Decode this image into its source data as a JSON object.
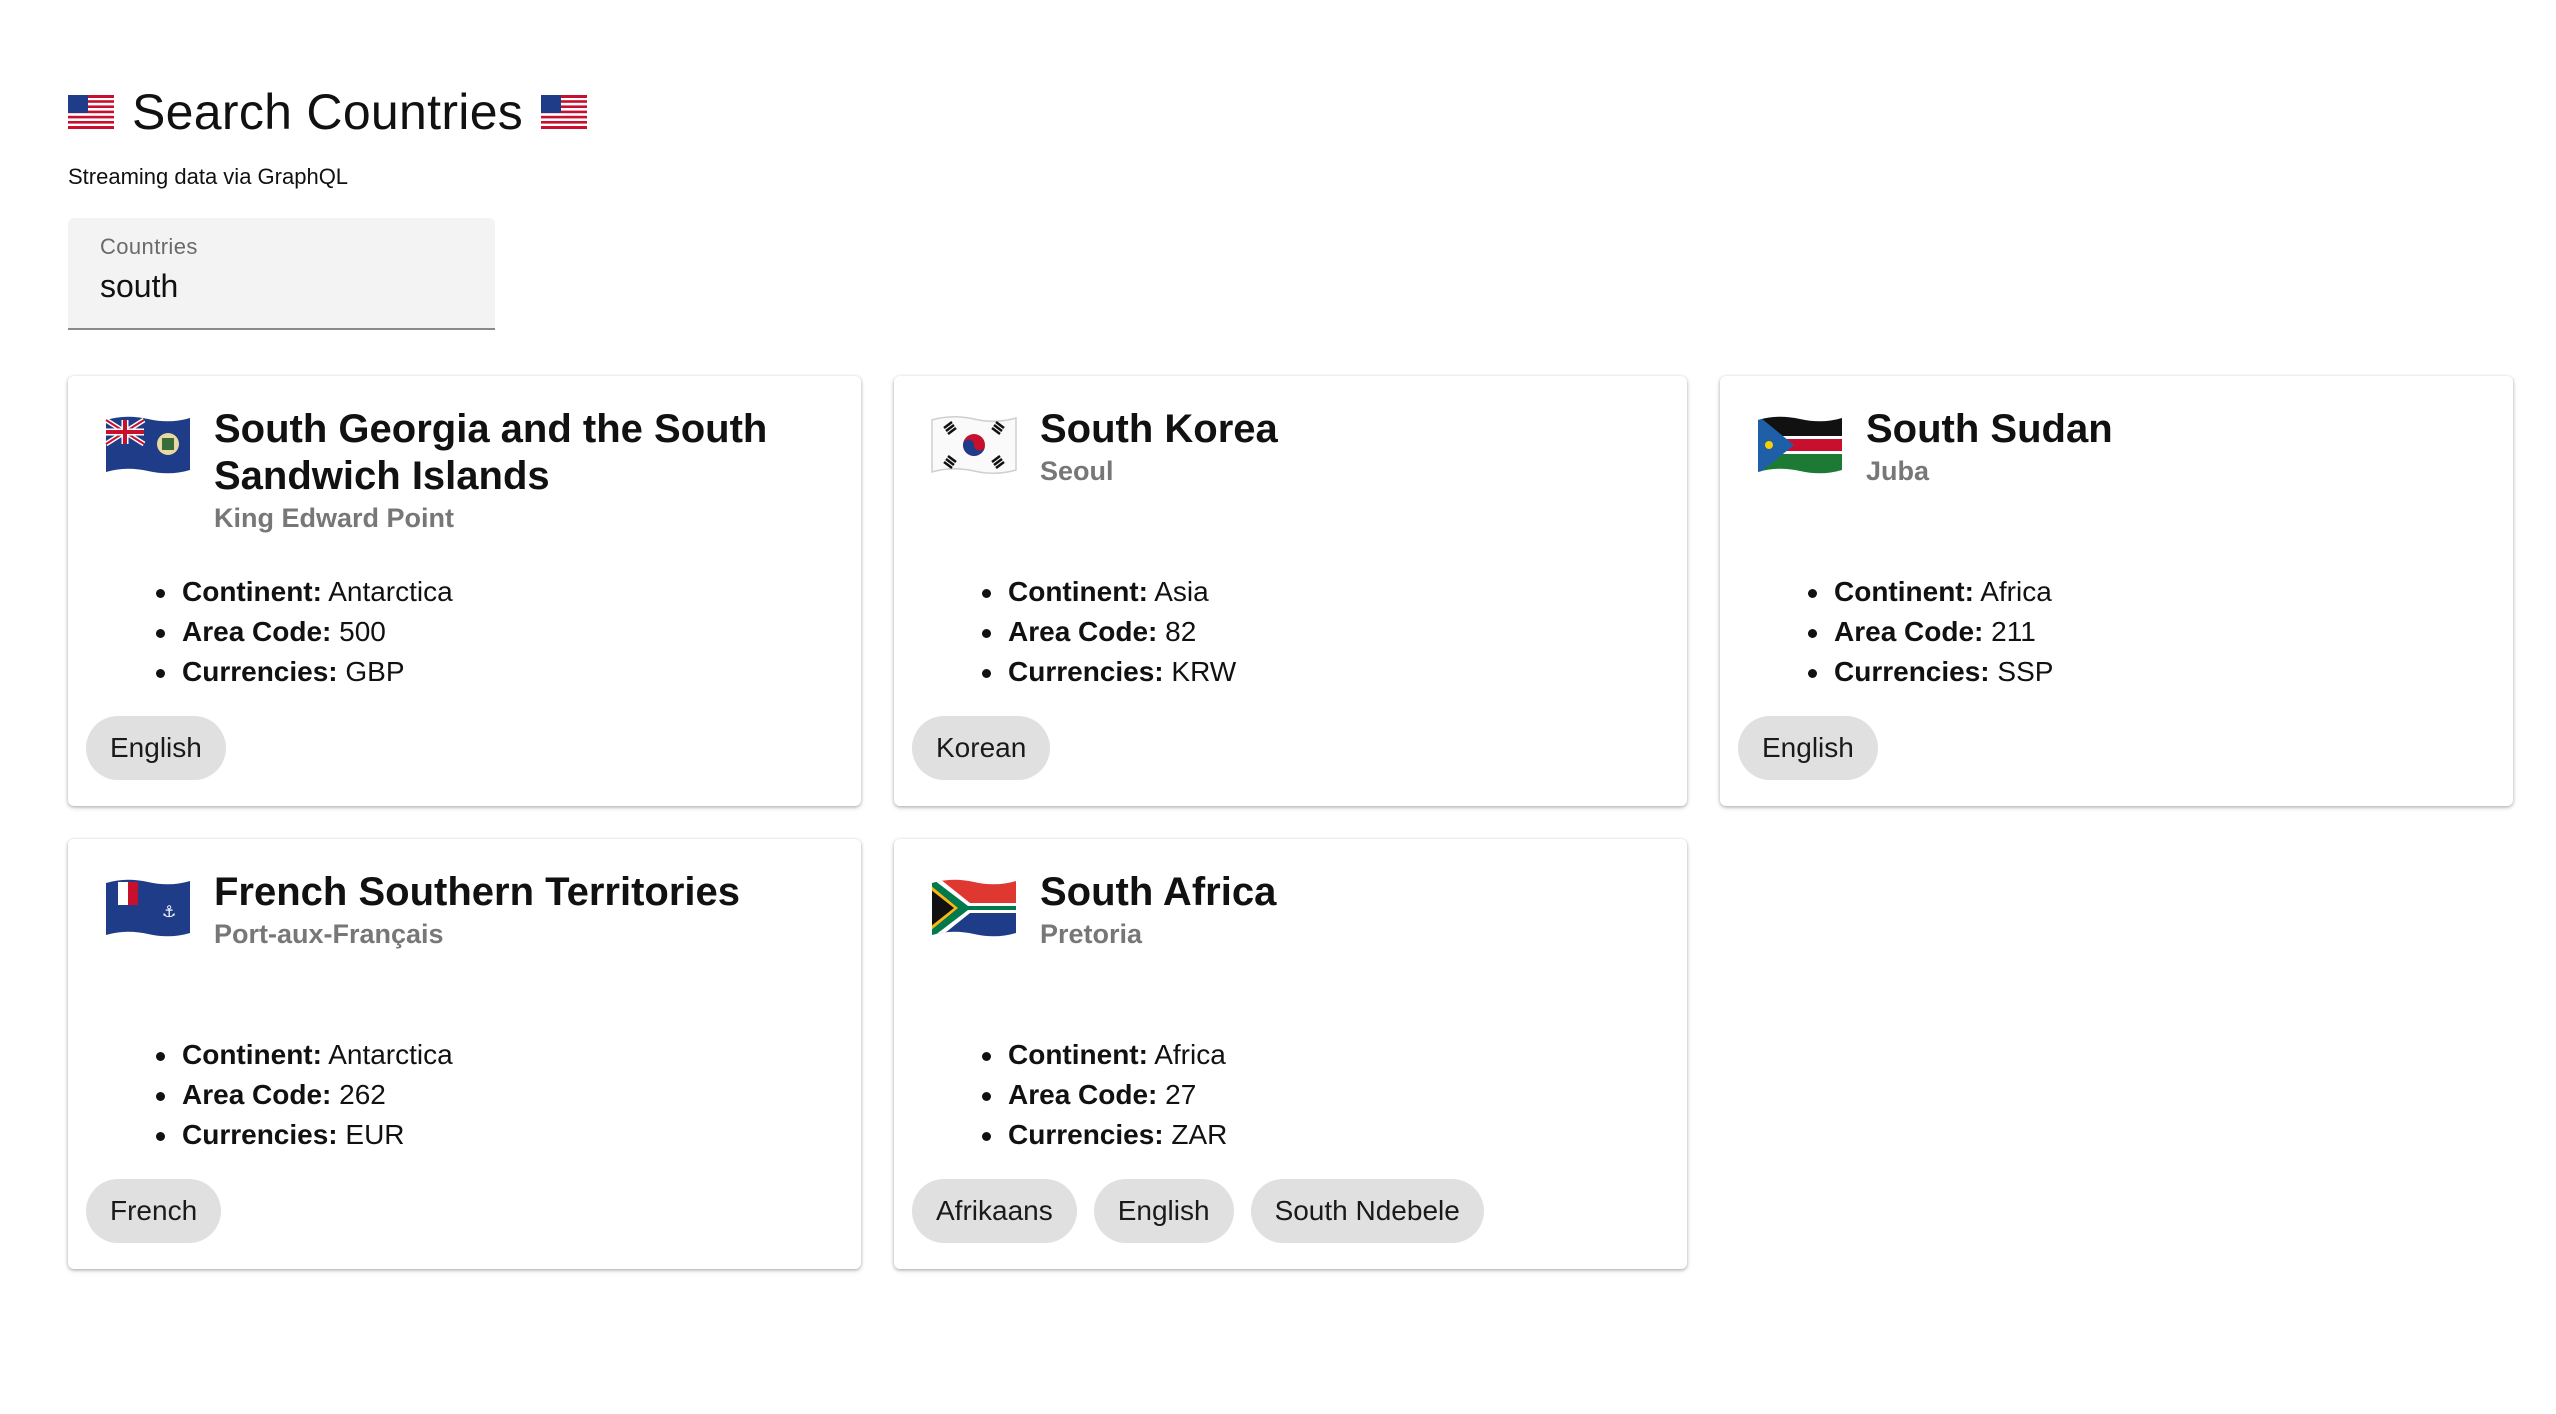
{
  "header": {
    "title": "Search Countries",
    "subtitle": "Streaming data via GraphQL",
    "title_flag_icon": "us-flag-icon"
  },
  "search": {
    "label": "Countries",
    "value": "south"
  },
  "fact_labels": {
    "continent": "Continent:",
    "area_code": "Area Code:",
    "currencies": "Currencies:"
  },
  "countries": [
    {
      "name": "South Georgia and the South Sandwich Islands",
      "capital": "King Edward Point",
      "continent": "Antarctica",
      "area_code": "500",
      "currencies": "GBP",
      "languages": [
        "English"
      ],
      "flag_icon": "south-georgia-flag-icon"
    },
    {
      "name": "South Korea",
      "capital": "Seoul",
      "continent": "Asia",
      "area_code": "82",
      "currencies": "KRW",
      "languages": [
        "Korean"
      ],
      "flag_icon": "south-korea-flag-icon"
    },
    {
      "name": "South Sudan",
      "capital": "Juba",
      "continent": "Africa",
      "area_code": "211",
      "currencies": "SSP",
      "languages": [
        "English"
      ],
      "flag_icon": "south-sudan-flag-icon"
    },
    {
      "name": "French Southern Territories",
      "capital": "Port-aux-Français",
      "continent": "Antarctica",
      "area_code": "262",
      "currencies": "EUR",
      "languages": [
        "French"
      ],
      "flag_icon": "french-southern-territories-flag-icon"
    },
    {
      "name": "South Africa",
      "capital": "Pretoria",
      "continent": "Africa",
      "area_code": "27",
      "currencies": "ZAR",
      "languages": [
        "Afrikaans",
        "English",
        "South Ndebele"
      ],
      "flag_icon": "south-africa-flag-icon"
    }
  ]
}
